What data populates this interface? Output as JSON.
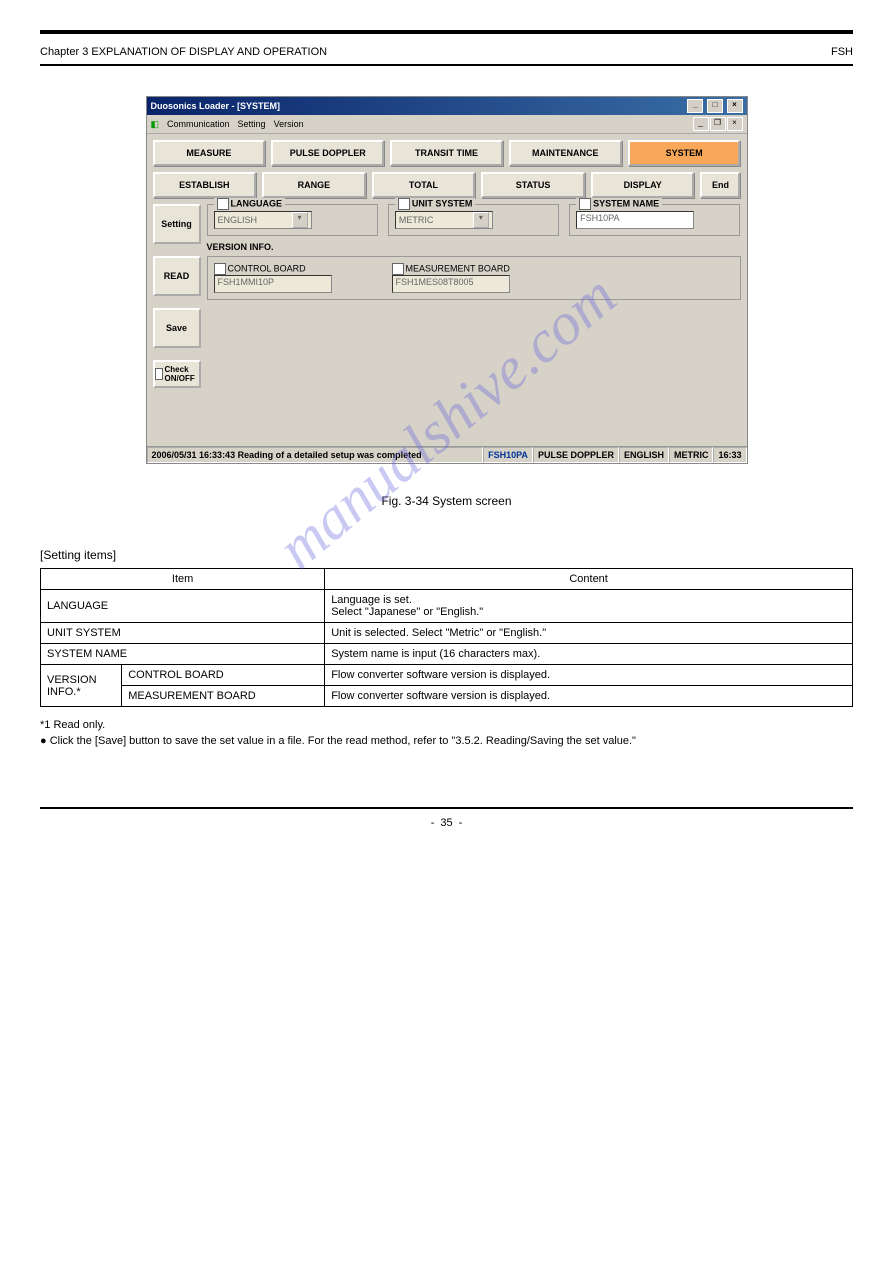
{
  "header": {
    "left": "Chapter 3    EXPLANATION OF DISPLAY AND OPERATION",
    "right": "FSH"
  },
  "window": {
    "title": "Duosonics Loader - [SYSTEM]",
    "menu": {
      "communication": "Communication",
      "setting": "Setting",
      "version": "Version"
    }
  },
  "tabs": {
    "row1": {
      "measure": "MEASURE",
      "pulse_doppler": "PULSE DOPPLER",
      "transit_time": "TRANSIT TIME",
      "maintenance": "MAINTENANCE",
      "system": "SYSTEM"
    },
    "row2": {
      "establish": "ESTABLISH",
      "range": "RANGE",
      "total": "TOTAL",
      "status": "STATUS",
      "display": "DISPLAY",
      "end": "End"
    }
  },
  "side": {
    "setting": "Setting",
    "read": "READ",
    "save": "Save",
    "check": "Check ON/OFF"
  },
  "form": {
    "language": {
      "label": "LANGUAGE",
      "value": "ENGLISH"
    },
    "unit_system": {
      "label": "UNIT SYSTEM",
      "value": "METRIC"
    },
    "system_name": {
      "label": "SYSTEM NAME",
      "value": "FSH10PA"
    },
    "version_info_label": "VERSION INFO.",
    "control_board": {
      "label": "CONTROL BOARD",
      "value": "FSH1MMI10P"
    },
    "measurement_board": {
      "label": "MEASUREMENT BOARD",
      "value": "FSH1MES08T8005"
    }
  },
  "status": {
    "message": "2006/05/31 16:33:43 Reading of a detailed setup was completed",
    "name": "FSH10PA",
    "mode": "PULSE DOPPLER",
    "lang": "ENGLISH",
    "unit": "METRIC",
    "time": "16:33"
  },
  "figure_caption": "Fig. 3-34 System screen",
  "section": {
    "label": "[Setting items]",
    "table": {
      "h_item": "Item",
      "h_content": "Content",
      "r1_item": "LANGUAGE",
      "r1_content": "Language is set.\nSelect \"Japanese\" or \"English.\"",
      "r2_item": "UNIT SYSTEM",
      "r2_content": "Unit is selected. Select \"Metric\" or \"English.\"",
      "r3_item": "SYSTEM NAME",
      "r3_content": "System name is input (16 characters max).",
      "r4_item_rowspan": "VERSION INFO.*",
      "r4a_item": "CONTROL BOARD",
      "r4a_content": "Flow converter software version is displayed.",
      "r4b_item": "MEASUREMENT BOARD",
      "r4b_content": "Flow converter software version is displayed."
    },
    "note1": "*1 Read only.",
    "note2": "● Click the [Save] button to save the set value in a file. For the read method, refer to \"3.5.2.  Reading/Saving the set value.\""
  },
  "footer": {
    "left": "-",
    "page": "35",
    "right": "-"
  },
  "watermark": "manualshive.com"
}
